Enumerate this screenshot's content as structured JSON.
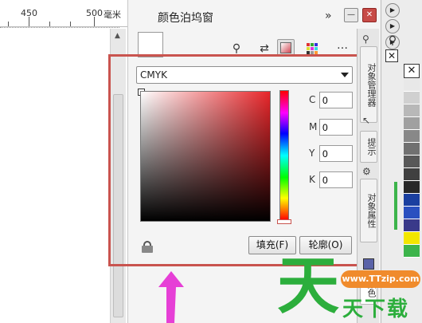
{
  "ruler": {
    "mark_450": "450",
    "mark_500": "500",
    "unit": "毫米"
  },
  "docker": {
    "title": "颜色泊坞窗",
    "expand_label": "»",
    "minimize_label": "—",
    "close_label": "✕",
    "model_value": "CMYK",
    "channels": [
      {
        "label": "C",
        "value": "0"
      },
      {
        "label": "M",
        "value": "0"
      },
      {
        "label": "Y",
        "value": "0"
      },
      {
        "label": "K",
        "value": "0"
      }
    ],
    "fill_button": "填充(F)",
    "outline_button": "轮廓(O)",
    "more_label": "…"
  },
  "side_tabs": {
    "object_manager": "对象管理器",
    "hints": "提示",
    "object_properties": "对象属性",
    "color": "颜色"
  },
  "palette": {
    "colors": [
      "#ffffff",
      "#e8e8e8",
      "#d0d0d0",
      "#b8b8b8",
      "#a0a0a0",
      "#888888",
      "#707070",
      "#585858",
      "#404040",
      "#282828",
      "#1a3fa0",
      "#2a50c0",
      "#f2e600",
      "#3cb44b"
    ]
  },
  "watermark": {
    "tian": "天",
    "url": "www.TTzip.com",
    "text": "天下载"
  },
  "colors": {
    "highlight": "#c9544f",
    "accent_green": "#2cae3c",
    "accent_orange": "#f08b2c"
  }
}
